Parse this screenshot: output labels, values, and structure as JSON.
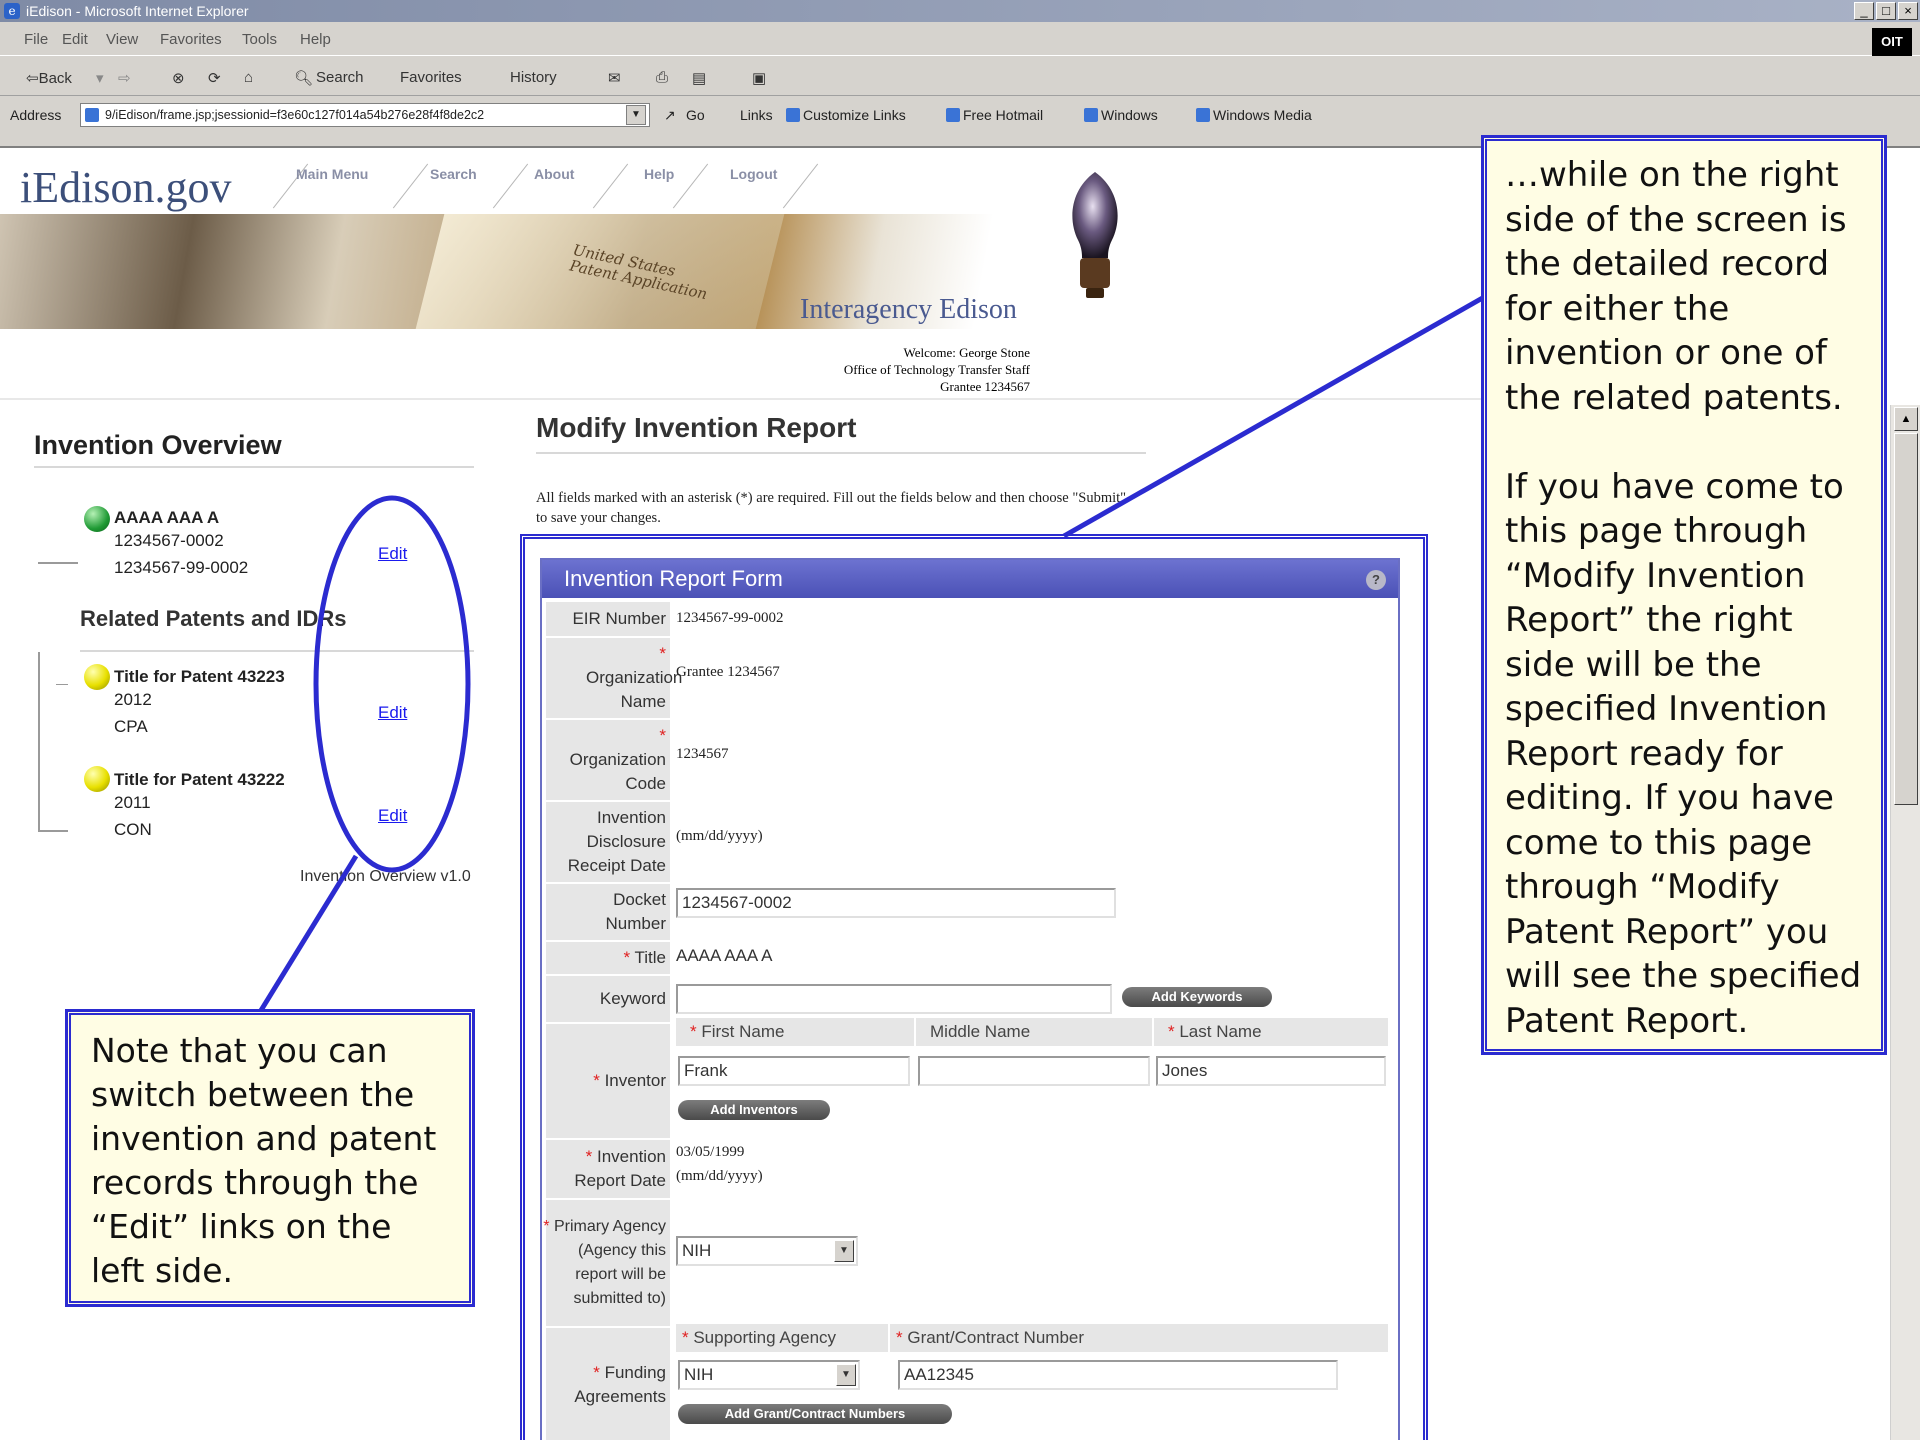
{
  "window": {
    "title": "iEdison - Microsoft Internet Explorer",
    "controls": [
      "_",
      "□",
      "×"
    ]
  },
  "menu": [
    "File",
    "Edit",
    "View",
    "Favorites",
    "Tools",
    "Help"
  ],
  "brand_badge": "OIT",
  "toolbar": {
    "back": "⇦Back",
    "forward": "⇨",
    "search": "Search",
    "favorites": "Favorites",
    "history": "History"
  },
  "address": {
    "label": "Address",
    "url": "9/iEdison/frame.jsp;jsessionid=f3e60c127f014a54b276e28f4f8de2c2",
    "go": "Go",
    "links": "Links",
    "link_items": [
      "Customize Links",
      "Free Hotmail",
      "Windows",
      "Windows Media"
    ]
  },
  "site": {
    "logo": "iEdison.gov",
    "nav": [
      "Main Menu",
      "Search",
      "About",
      "Help",
      "Logout"
    ],
    "banner_text": "United States\nPatent Application",
    "subtitle": "Interagency Edison",
    "welcome": [
      "Welcome: George Stone",
      "Office of Technology Transfer Staff",
      "Grantee 1234567"
    ]
  },
  "overview": {
    "title": "Invention Overview",
    "invention": {
      "title": "AAAA AAA A",
      "line1": "1234567-0002",
      "line2": "1234567-99-0002",
      "edit": "Edit",
      "status": "green"
    },
    "related_title": "Related Patents and IDRs",
    "patents": [
      {
        "title": "Title for Patent 43223",
        "year": "2012",
        "type": "CPA",
        "edit": "Edit",
        "status": "yellow"
      },
      {
        "title": "Title for Patent 43222",
        "year": "2011",
        "type": "CON",
        "edit": "Edit",
        "status": "yellow"
      }
    ],
    "version": "Invention Overview v1.0"
  },
  "main": {
    "title": "Modify Invention Report",
    "instructions": "All fields marked with an asterisk (*) are required. Fill out the fields below and then choose \"Submit\" to save your changes."
  },
  "form": {
    "title": "Invention Report Form",
    "help": "?",
    "eir_label": "EIR Number",
    "eir_value": "1234567-99-0002",
    "org_name_label": "Organization Name",
    "org_name_value": "Grantee 1234567",
    "org_code_label": "Organization Code",
    "org_code_value": "1234567",
    "disclosure_label": "Invention Disclosure Receipt Date",
    "disclosure_value": "(mm/dd/yyyy)",
    "docket_label": "Docket Number",
    "docket_value": "1234567-0002",
    "title_label": "Title",
    "title_value": "AAAA AAA A",
    "keyword_label": "Keyword",
    "keyword_value": "",
    "add_keywords": "Add Keywords",
    "inventor_label": "Inventor",
    "inv_first_hdr": "First Name",
    "inv_middle_hdr": "Middle Name",
    "inv_last_hdr": "Last Name",
    "inv_first": "Frank",
    "inv_middle": "",
    "inv_last": "Jones",
    "add_inventors": "Add Inventors",
    "report_date_label": "Invention Report Date",
    "report_date_value": "03/05/1999",
    "report_date_fmt": "(mm/dd/yyyy)",
    "primary_agency_label": "Primary Agency (Agency this report will be submitted to)",
    "primary_agency_value": "NIH",
    "funding_label": "Funding Agreements",
    "supporting_agency_hdr": "Supporting Agency",
    "grant_hdr": "Grant/Contract Number",
    "supporting_agency_value": "NIH",
    "grant_value": "AA12345",
    "add_grants": "Add Grant/Contract Numbers"
  },
  "callouts": {
    "right": "…while on the right side of the screen is the detailed record for either the invention or one of the related patents.\n\nIf you have come to this page through “Modify Invention Report” the right side will be the specified Invention Report ready for editing.  If you have come to this page through “Modify Patent Report” you will see the specified Patent Report.",
    "left": "Note that you can switch between the invention and patent records through the “Edit” links on the left side."
  },
  "colors": {
    "callout_border": "#2b2bd0",
    "callout_bg": "#fffde4",
    "form_header": "#5a60c2",
    "link": "#1a1aee"
  }
}
